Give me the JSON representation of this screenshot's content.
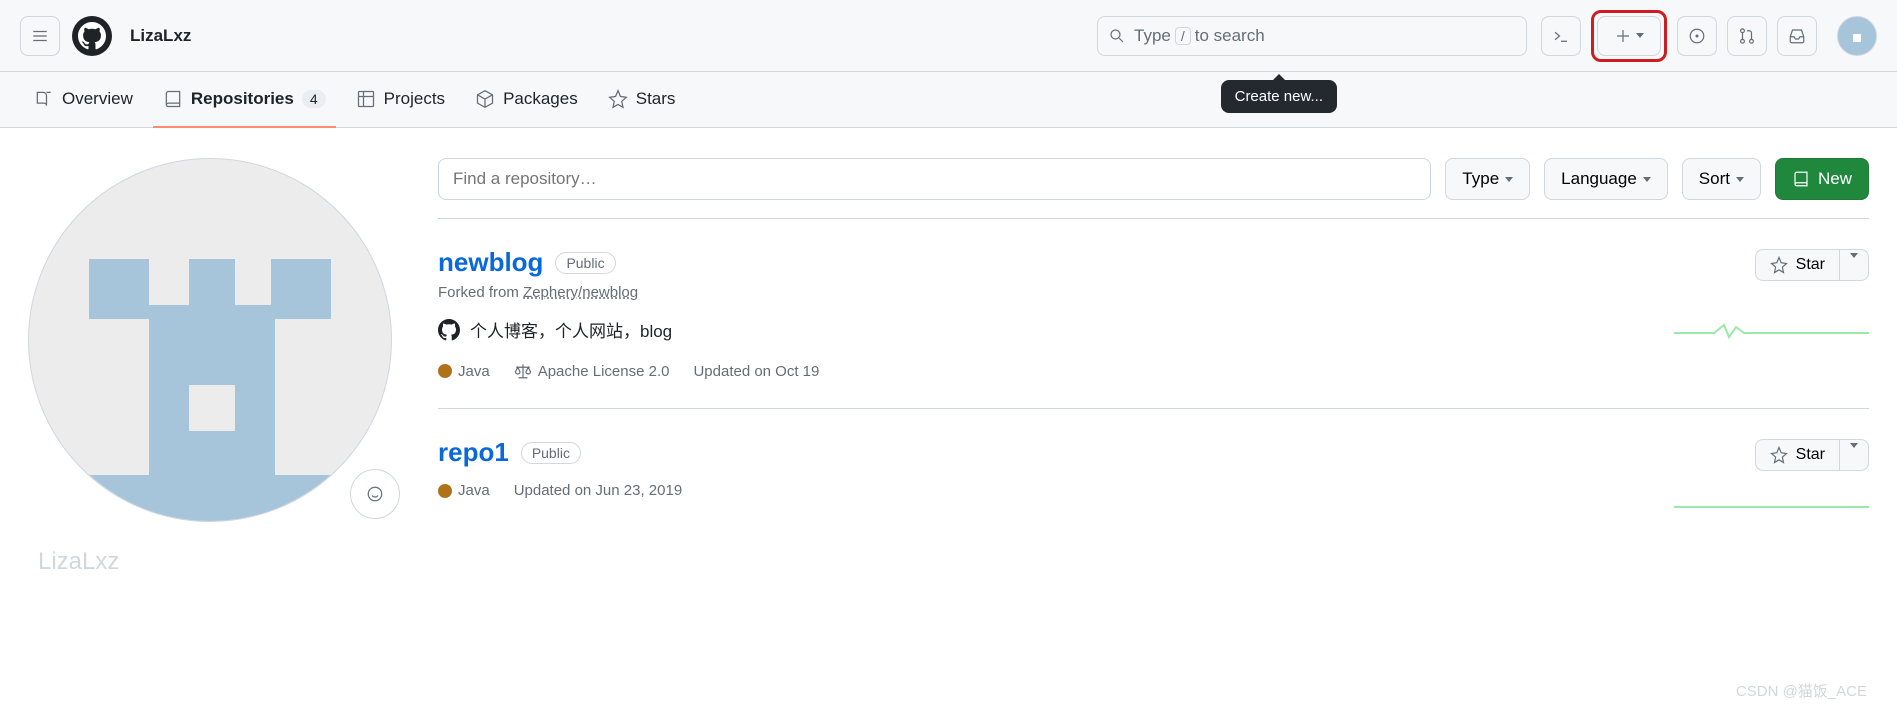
{
  "header": {
    "username": "LizaLxz",
    "search_prefix": "Type",
    "search_suffix": "to search",
    "slash": "/",
    "tooltip": "Create new..."
  },
  "tabs": {
    "overview": "Overview",
    "repositories": "Repositories",
    "repo_count": "4",
    "projects": "Projects",
    "packages": "Packages",
    "stars": "Stars"
  },
  "sidebar": {
    "under_name": "LizaLxz"
  },
  "filters": {
    "placeholder": "Find a repository…",
    "type": "Type",
    "language": "Language",
    "sort": "Sort",
    "new": "New"
  },
  "repos": [
    {
      "name": "newblog",
      "visibility": "Public",
      "forked_prefix": "Forked from ",
      "forked_from": "Zephery/newblog",
      "description": "个人博客，个人网站，blog",
      "language": "Java",
      "license": "Apache License 2.0",
      "updated": "Updated on Oct 19"
    },
    {
      "name": "repo1",
      "visibility": "Public",
      "forked_prefix": "",
      "forked_from": "",
      "description": "",
      "language": "Java",
      "license": "",
      "updated": "Updated on Jun 23, 2019"
    }
  ],
  "star_label": "Star",
  "watermark": "CSDN @猫饭_ACE"
}
